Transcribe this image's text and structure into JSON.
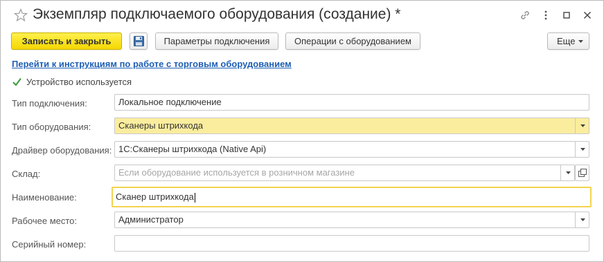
{
  "window": {
    "title": "Экземпляр подключаемого оборудования (создание) *"
  },
  "toolbar": {
    "save_close_label": "Записать и закрыть",
    "connection_params_label": "Параметры подключения",
    "operations_label": "Операции с оборудованием",
    "more_label": "Еще"
  },
  "help_link": "Перейти к инструкциям по работе с торговым оборудованием",
  "device_used": {
    "label": "Устройство используется",
    "checked": true
  },
  "form": {
    "connection_type": {
      "label": "Тип подключения:",
      "value": "Локальное подключение"
    },
    "equipment_type": {
      "label": "Тип оборудования:",
      "value": "Сканеры штрихкода"
    },
    "driver": {
      "label": "Драйвер оборудования:",
      "value": "1С:Сканеры штрихкода (Native Api)"
    },
    "warehouse": {
      "label": "Склад:",
      "value": "",
      "placeholder": "Если оборудование используется в розничном магазине"
    },
    "name": {
      "label": "Наименование:",
      "value": "Сканер штрихкода"
    },
    "workplace": {
      "label": "Рабочее место:",
      "value": "Администратор"
    },
    "serial": {
      "label": "Серийный номер:",
      "value": ""
    }
  },
  "icons": {
    "favorite": "star-icon",
    "link": "link-icon",
    "menu": "more-vert-icon",
    "maximize": "maximize-icon",
    "close": "close-icon",
    "save": "floppy-disk-icon",
    "dropdown": "chevron-down-icon",
    "open": "open-form-icon",
    "check": "checkmark-icon"
  },
  "colors": {
    "primary_button": "#f5d700",
    "link": "#1e5fb4",
    "highlight_field": "#fbed9e",
    "focus_border": "#f3d34e",
    "check": "#3a9a3a"
  }
}
